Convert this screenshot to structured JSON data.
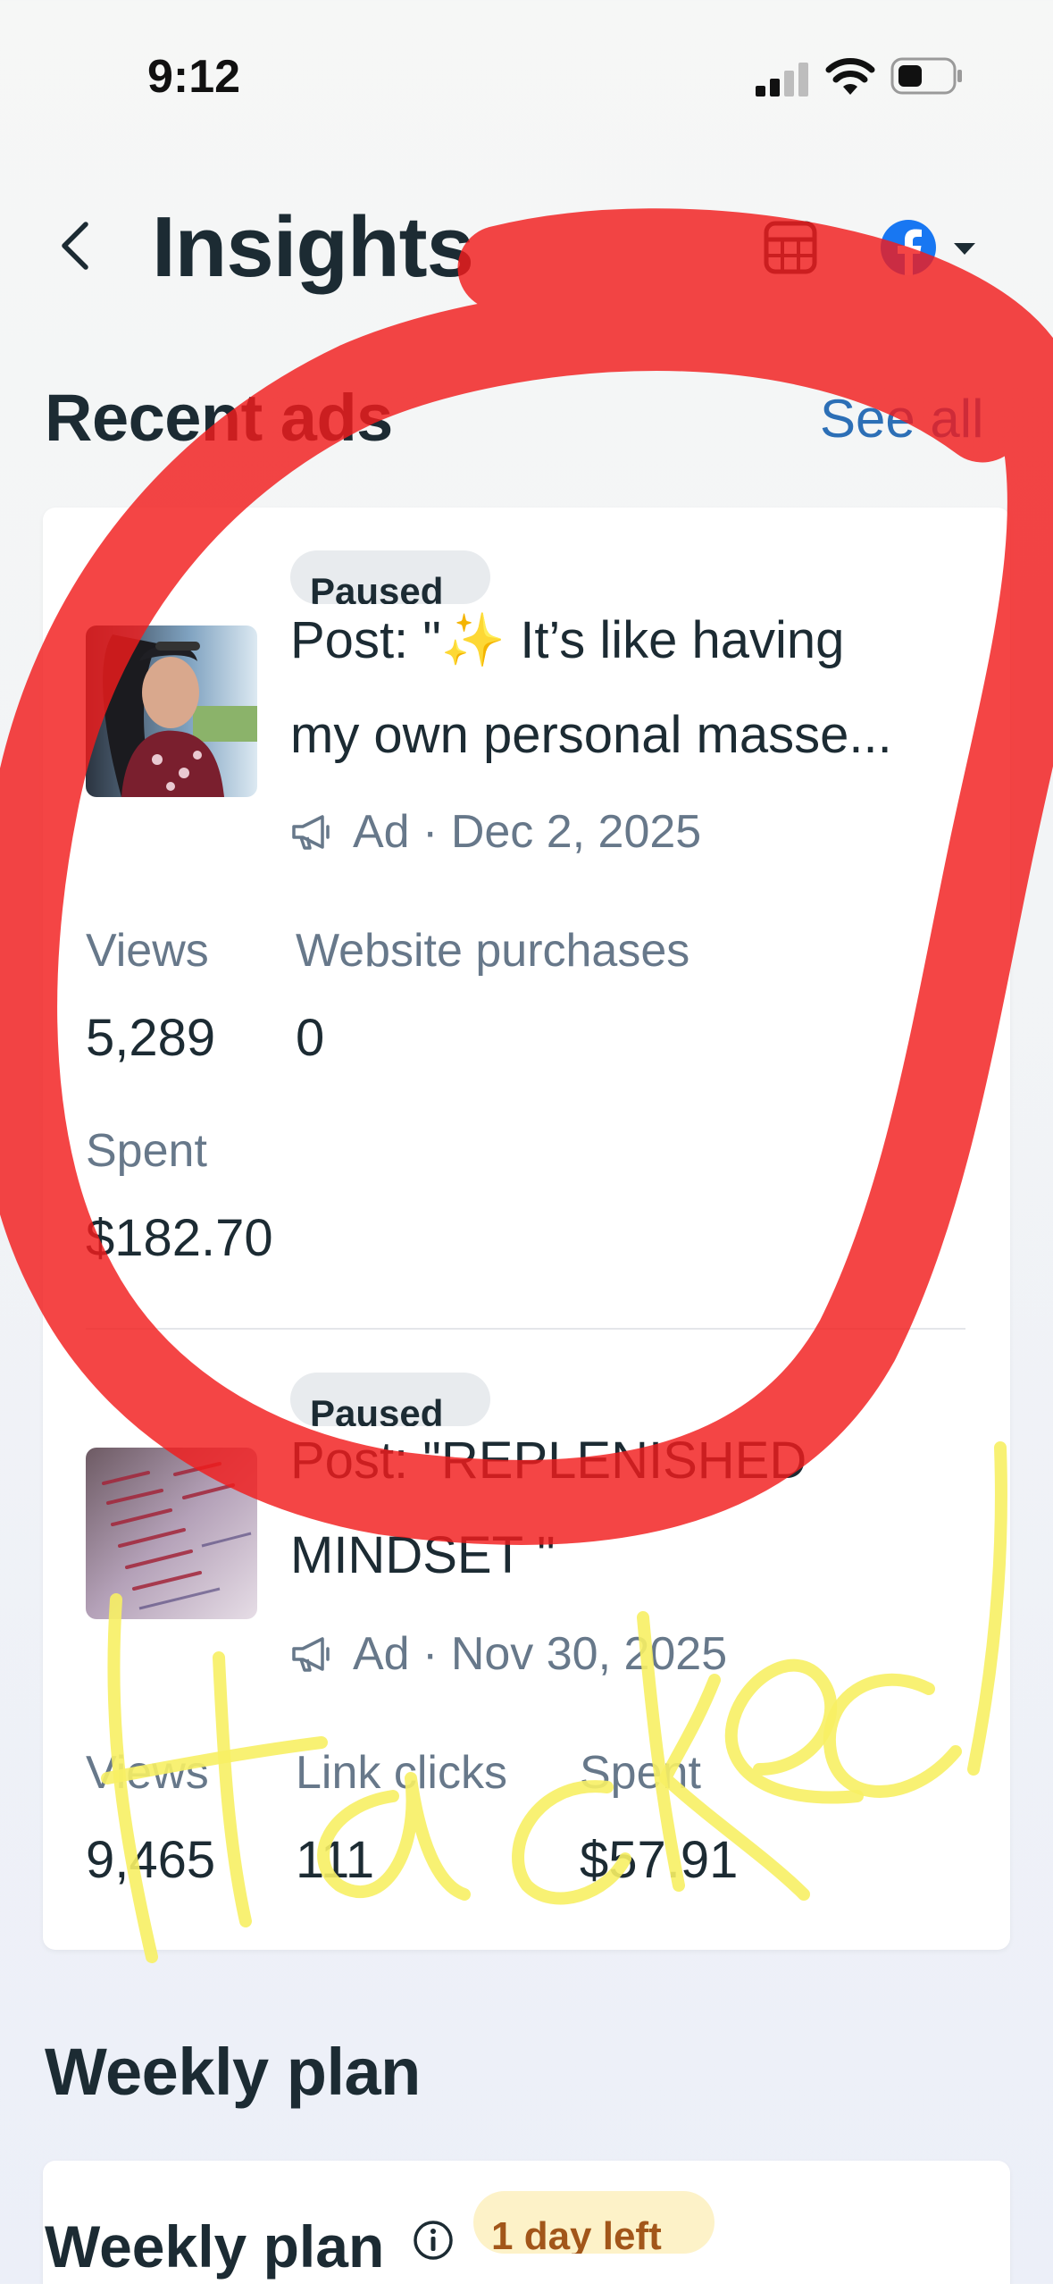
{
  "status_bar": {
    "time": "9:12"
  },
  "header": {
    "title": "Insights"
  },
  "recent_ads": {
    "title": "Recent ads",
    "see_all": "See all",
    "ads": [
      {
        "status": "Paused",
        "title_line1": "Post: \"✨ It’s like having",
        "title_line2": "my own personal masse...",
        "meta": "Ad · Dec 2, 2025",
        "metrics": [
          {
            "label": "Views",
            "value": "5,289"
          },
          {
            "label": "Website purchases",
            "value": "0"
          },
          {
            "label": "Spent",
            "value": "$182.70"
          }
        ]
      },
      {
        "status": "Paused",
        "title_line1": "Post: \"REPLENISHED",
        "title_line2": "MINDSET \"",
        "meta": "Ad · Nov 30, 2025",
        "metrics": [
          {
            "label": "Views",
            "value": "9,465"
          },
          {
            "label": "Link clicks",
            "value": "111"
          },
          {
            "label": "Spent",
            "value": "$57.91"
          }
        ]
      }
    ]
  },
  "weekly_plan": {
    "section_title": "Weekly plan",
    "card_title": "Weekly plan",
    "badge": "1 day left"
  },
  "overlay": {
    "handwritten_text": "Hacked"
  },
  "colors": {
    "accent_link": "#2c6fb6",
    "facebook_blue": "#1877f2",
    "annotation_red": "#f21c1c",
    "annotation_yellow": "#f7f064",
    "badge_bg": "#fdf2c8",
    "badge_text": "#a2561a"
  },
  "icons": [
    "back-chevron-icon",
    "calculator-icon",
    "facebook-icon",
    "caret-down-icon",
    "megaphone-icon",
    "info-icon"
  ]
}
